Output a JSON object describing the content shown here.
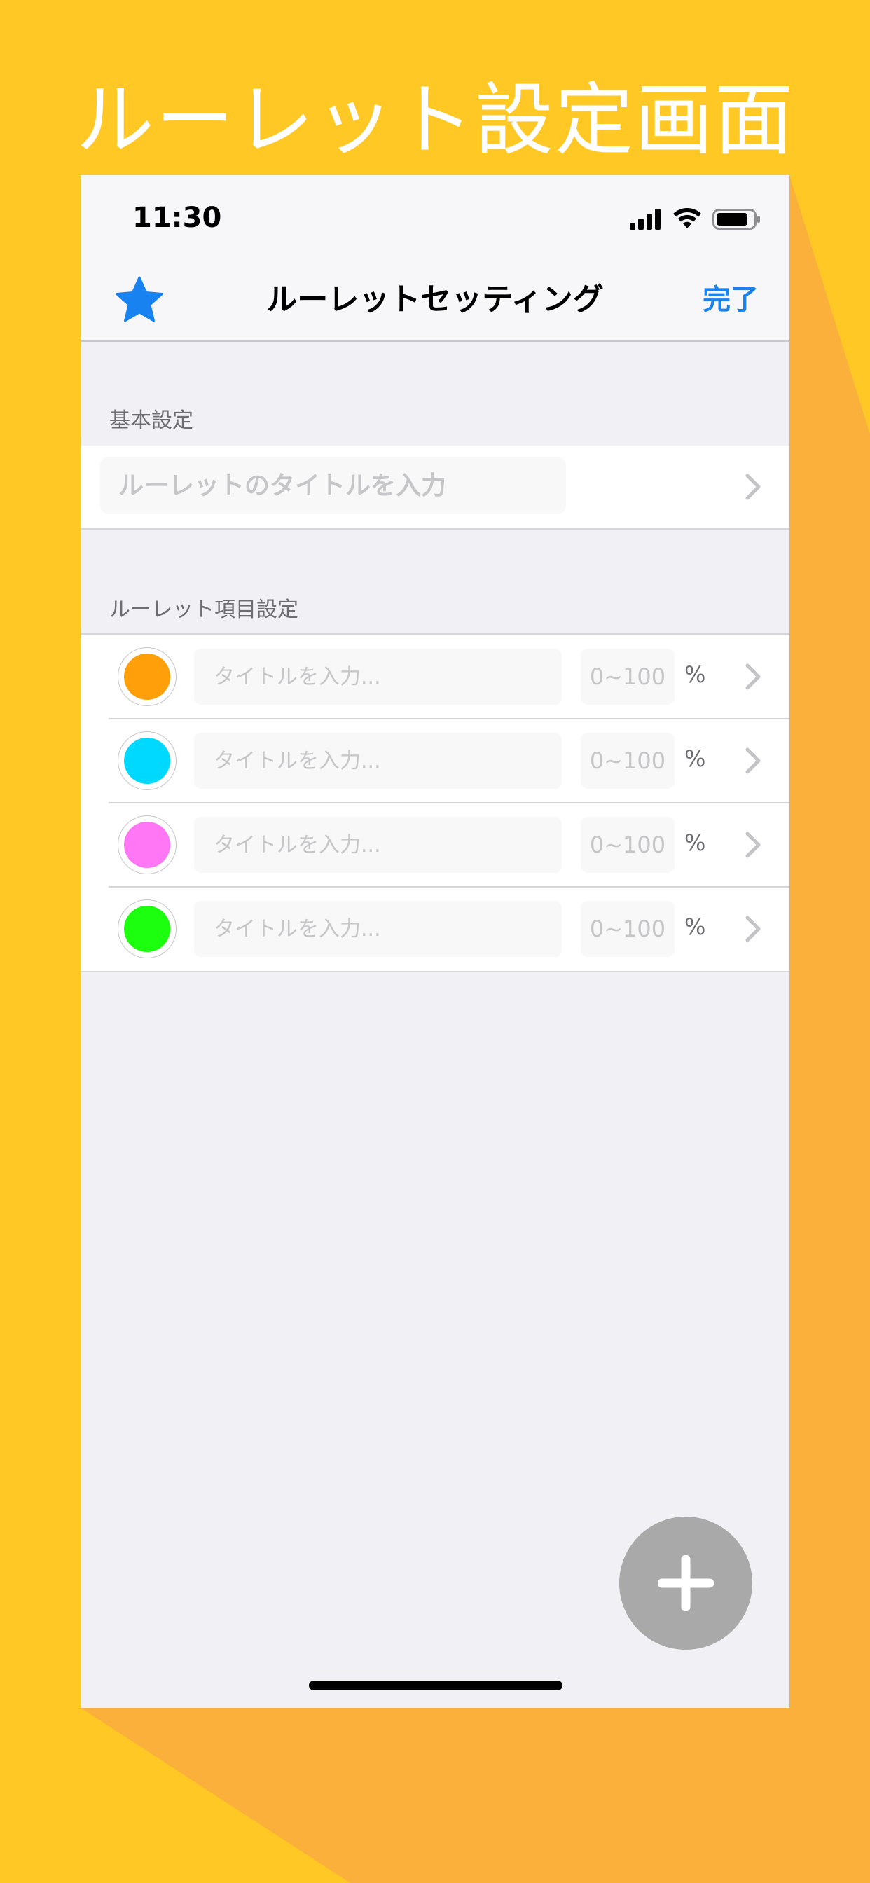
{
  "promo": {
    "title": "ルーレット設定画面",
    "colors": {
      "yellow": "#FFC824",
      "orange_shadow": "#FBB03B"
    }
  },
  "status_bar": {
    "time": "11:30",
    "icons": [
      "signal-icon",
      "wifi-icon",
      "battery-icon"
    ]
  },
  "nav": {
    "left_icon": "star-icon",
    "title": "ルーレットセッティング",
    "done_label": "完了",
    "accent_color": "#1782F0"
  },
  "basic_section": {
    "header": "基本設定",
    "title_placeholder": "ルーレットのタイトルを入力"
  },
  "items_section": {
    "header": "ルーレット項目設定",
    "items": [
      {
        "color": "#FF9F0A",
        "title_placeholder": "タイトルを入力...",
        "percent_placeholder": "0~100",
        "unit": "%"
      },
      {
        "color": "#00D9FF",
        "title_placeholder": "タイトルを入力...",
        "percent_placeholder": "0~100",
        "unit": "%"
      },
      {
        "color": "#FF77F5",
        "title_placeholder": "タイトルを入力...",
        "percent_placeholder": "0~100",
        "unit": "%"
      },
      {
        "color": "#1CFF0E",
        "title_placeholder": "タイトルを入力...",
        "percent_placeholder": "0~100",
        "unit": "%"
      }
    ]
  },
  "fab": {
    "icon": "plus-icon"
  }
}
